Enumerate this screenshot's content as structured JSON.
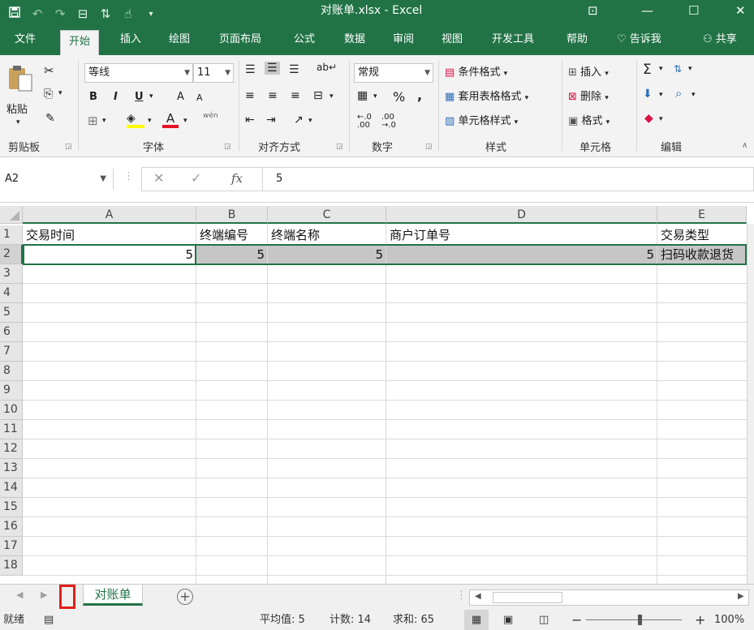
{
  "titlebar": {
    "title": "对账单.xlsx  -  Excel",
    "qat_icons": [
      "save-icon",
      "undo-icon",
      "redo-icon",
      "form-icon",
      "sort-icon",
      "touch-icon",
      "customize-icon"
    ],
    "colors": {
      "accent": "#217346"
    }
  },
  "ribbon_tabs": {
    "file": "文件",
    "home": "开始",
    "insert": "插入",
    "draw": "绘图",
    "page_layout": "页面布局",
    "formulas": "公式",
    "data": "数据",
    "review": "审阅",
    "view": "视图",
    "developer": "开发工具",
    "help": "帮助",
    "tell_me": "告诉我",
    "share": "共享"
  },
  "ribbon": {
    "clipboard": {
      "paste": "粘贴",
      "label": "剪贴板"
    },
    "font": {
      "name": "等线",
      "size": "11",
      "bold": "B",
      "italic": "I",
      "underline": "U",
      "grow": "A",
      "shrink": "A",
      "color_a": "A",
      "phonetic": "wén",
      "label": "字体"
    },
    "alignment": {
      "label": "对齐方式"
    },
    "number": {
      "format": "常规",
      "percent": "%",
      "comma": ",",
      "label": "数字"
    },
    "styles": {
      "conditional": "条件格式",
      "table": "套用表格格式",
      "cell_styles": "单元格样式",
      "label": "样式"
    },
    "cells": {
      "insert": "插入",
      "delete": "删除",
      "format": "格式",
      "label": "单元格"
    },
    "editing": {
      "label": "编辑"
    }
  },
  "formula_bar": {
    "name_box": "A2",
    "fx": "fx",
    "value": "5"
  },
  "grid": {
    "columns": [
      "A",
      "B",
      "C",
      "D",
      "E"
    ],
    "rows": [
      "1",
      "2",
      "3",
      "4",
      "5",
      "6",
      "7",
      "8",
      "9",
      "10",
      "11",
      "12",
      "13",
      "14",
      "15",
      "16",
      "17",
      "18"
    ],
    "header_row": {
      "a": "交易时间",
      "b": "终端编号",
      "c": "终端名称",
      "d": "商户订单号",
      "e": "交易类型"
    },
    "data_row": {
      "a": "5",
      "b": "5",
      "c": "5",
      "d": "5",
      "e": "扫码收款退货"
    }
  },
  "sheets": {
    "active": "对账单",
    "add": "+"
  },
  "status": {
    "ready": "就绪",
    "average": "平均值: 5",
    "count": "计数: 14",
    "sum": "求和: 65",
    "zoom_minus": "−",
    "zoom_plus": "+",
    "zoom": "100%"
  }
}
